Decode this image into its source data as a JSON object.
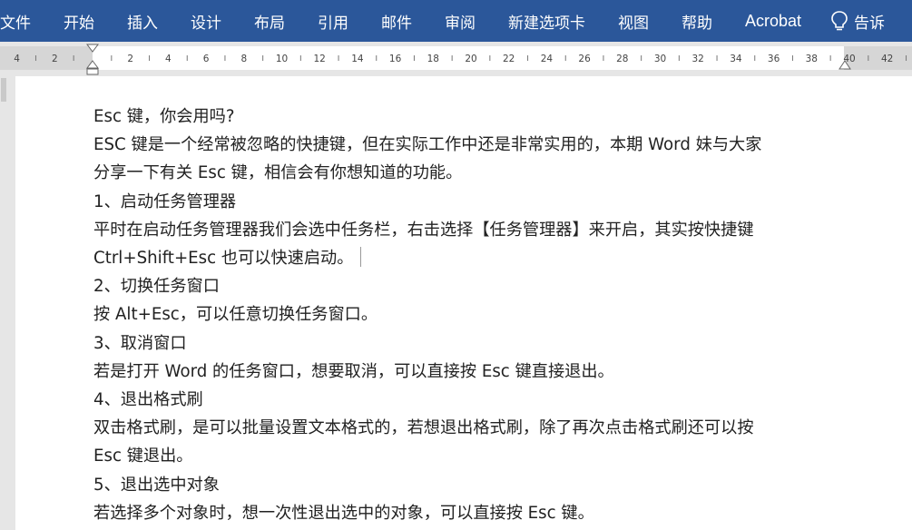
{
  "ribbon": {
    "tabs": [
      "文件",
      "开始",
      "插入",
      "设计",
      "布局",
      "引用",
      "邮件",
      "审阅",
      "新建选项卡",
      "视图",
      "帮助",
      "Acrobat"
    ],
    "tell_me": "告诉"
  },
  "ruler": {
    "labels": [
      "4",
      "2",
      "2",
      "4",
      "6",
      "8",
      "10",
      "12",
      "14",
      "16",
      "18",
      "20",
      "22",
      "24",
      "26",
      "28",
      "30",
      "32",
      "34",
      "36",
      "38",
      "40",
      "42"
    ]
  },
  "document": {
    "lines": [
      "Esc 键，你会用吗?",
      "ESC 键是一个经常被忽略的快捷键，但在实际工作中还是非常实用的，本期 Word 妹与大家",
      "分享一下有关 Esc 键，相信会有你想知道的功能。",
      "1、启动任务管理器",
      "平时在启动任务管理器我们会选中任务栏，右击选择【任务管理器】来开启，其实按快捷键",
      "Ctrl+Shift+Esc 也可以快速启动。",
      "2、切换任务窗口",
      "按 Alt+Esc，可以任意切换任务窗口。",
      "3、取消窗口",
      "若是打开 Word 的任务窗口，想要取消，可以直接按 Esc 键直接退出。",
      "4、退出格式刷",
      "双击格式刷，是可以批量设置文本格式的，若想退出格式刷，除了再次点击格式刷还可以按",
      "Esc 键退出。",
      "5、退出选中对象",
      "若选择多个对象时，想一次性退出选中的对象，可以直接按 Esc 键。"
    ]
  }
}
